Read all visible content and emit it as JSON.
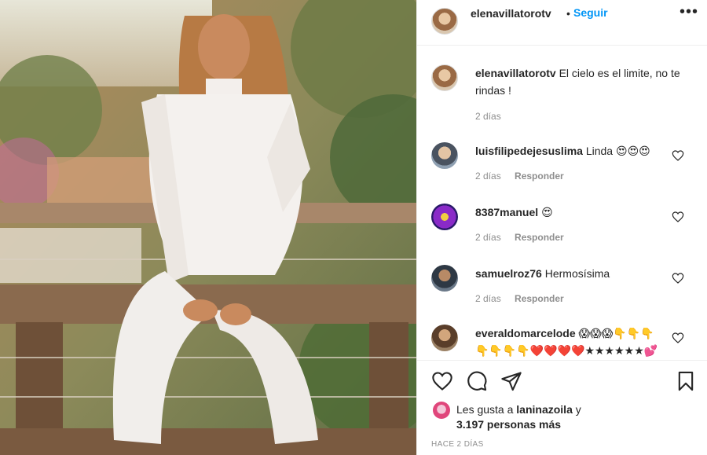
{
  "post": {
    "image_alt": "Woman in white lace outfit sitting on a wooden railing in sunlight",
    "owner": {
      "username": "elenavillatorotv",
      "separator": "•",
      "follow_label": "Seguir",
      "more_label": "•••"
    },
    "caption": {
      "username": "elenavillatorotv",
      "text": "El cielo es el limite, no te rindas !",
      "time": "2 días"
    },
    "comments": [
      {
        "username": "luisfilipedejesuslima",
        "text": "Linda 😍😍😍",
        "time": "2 días",
        "reply_label": "Responder",
        "avatar_color": "#6b7b8c"
      },
      {
        "username": "8387manuel",
        "text": "😍",
        "time": "2 días",
        "reply_label": "Responder",
        "avatar_color": "#5a2ea0"
      },
      {
        "username": "samuelroz76",
        "text": "Hermosísima",
        "time": "2 días",
        "reply_label": "Responder",
        "avatar_color": "#3d4a5a"
      },
      {
        "username": "everaldomarcelode",
        "text": "😱😱😱👇👇👇👇👇👇👇❤️❤️❤️❤️★★★★★★💕💕💕",
        "time": "",
        "reply_label": "",
        "avatar_color": "#8a6a4a"
      }
    ],
    "likes": {
      "prefix": "Les gusta a",
      "user": "laninazoila",
      "suffix": "y",
      "count_text": "3.197 personas más"
    },
    "time_ago": "HACE 2 DÍAS",
    "icons": [
      "heart-icon",
      "comment-icon",
      "share-icon",
      "bookmark-icon",
      "more-icon"
    ]
  }
}
